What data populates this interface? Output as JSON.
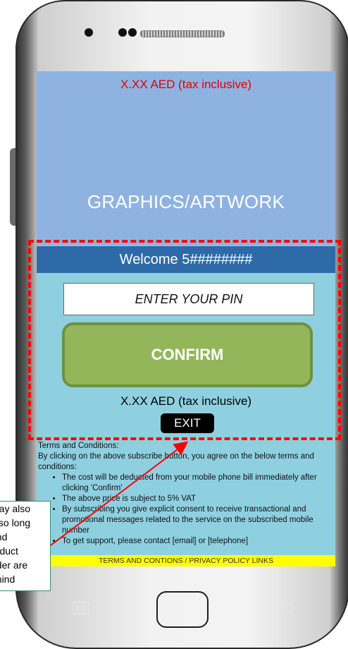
{
  "screen": {
    "price_top": "X.XX AED  (tax inclusive)",
    "graphics_label": "GRAPHICS/ARTWORK",
    "welcome": "Welcome 5########",
    "pin_placeholder": "ENTER YOUR PIN",
    "confirm_label": "CONFIRM",
    "price_mid": "X.XX AED (tax inclusive)",
    "exit_label": "EXIT",
    "terms": {
      "heading": "Terms and Conditions:",
      "intro": "By clicking on the above subscribe button, you agree on the below terms and conditions:",
      "items": [
        "The cost will be deducted from your mobile phone bill immediately after clicking 'Confirm'",
        "The above price is subject to 5% VAT",
        "By subscribing you give explicit consent to receive transactional and promotional messages related to the service on the subscribed mobile number",
        "To get support, please contact [email] or [telephone]"
      ]
    },
    "footer_links": "TERMS AND CONTIONS / PRIVACY POLICY LINKS"
  },
  "callout": {
    "lines": [
      "may also",
      "k so long",
      "and",
      "roduct",
      "ader are",
      "ehind"
    ]
  },
  "colors": {
    "banner": "#8fb3e0",
    "welcome_bar": "#2e6aa8",
    "confirm": "#94b65a",
    "background": "#8fd0e0",
    "highlight": "#ff0000"
  }
}
